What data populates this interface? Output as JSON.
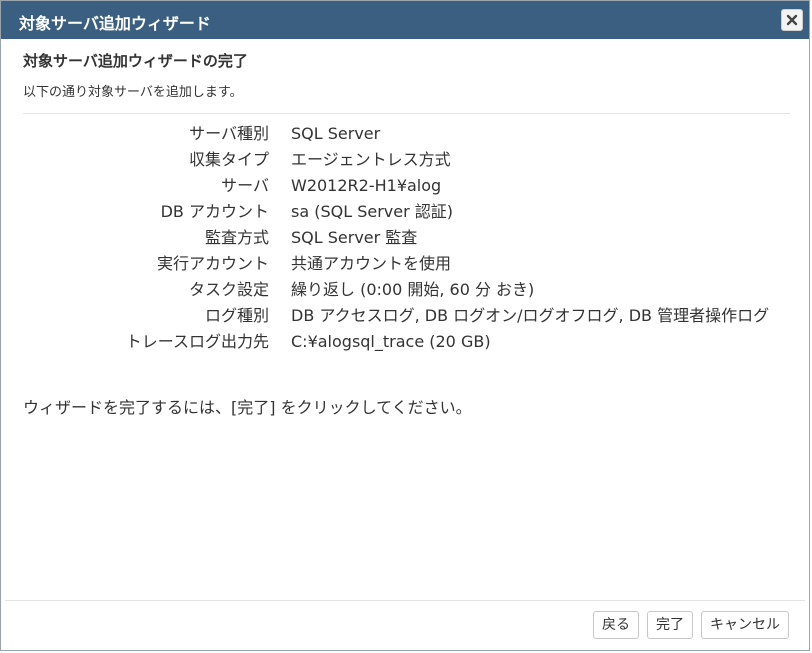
{
  "dialog": {
    "title": "対象サーバ追加ウィザード",
    "close_label": "×"
  },
  "content": {
    "heading": "対象サーバ追加ウィザードの完了",
    "subtext": "以下の通り対象サーバを追加します。",
    "summary": [
      {
        "label": "サーバ種別",
        "value": "SQL Server"
      },
      {
        "label": "収集タイプ",
        "value": "エージェントレス方式"
      },
      {
        "label": "サーバ",
        "value": "W2012R2-H1¥alog"
      },
      {
        "label": "DB アカウント",
        "value": "sa (SQL Server 認証)"
      },
      {
        "label": "監査方式",
        "value": "SQL Server 監査"
      },
      {
        "label": "実行アカウント",
        "value": "共通アカウントを使用"
      },
      {
        "label": "タスク設定",
        "value": "繰り返し (0:00 開始, 60 分 おき)"
      },
      {
        "label": "ログ種別",
        "value": "DB アクセスログ, DB ログオン/ログオフログ, DB 管理者操作ログ"
      },
      {
        "label": "トレースログ出力先",
        "value": "C:¥alogsql_trace (20 GB)"
      }
    ],
    "footer_note": "ウィザードを完了するには、[完了] をクリックしてください。"
  },
  "buttons": {
    "back": "戻る",
    "finish": "完了",
    "cancel": "キャンセル"
  },
  "colors": {
    "titlebar": "#3a5f80",
    "text": "#333333"
  }
}
